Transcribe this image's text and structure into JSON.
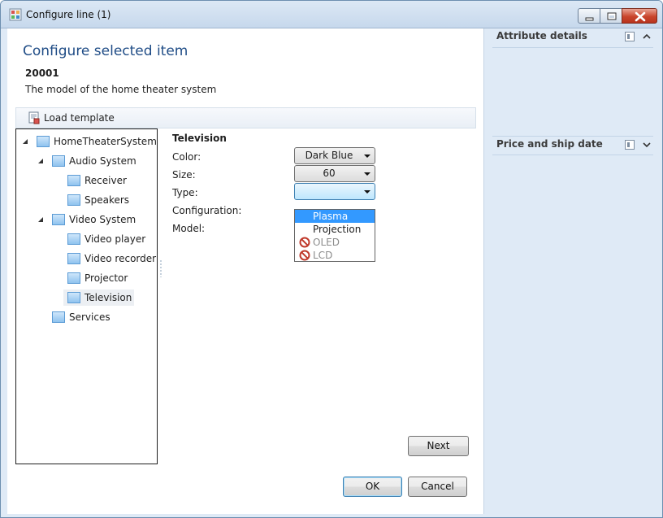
{
  "window": {
    "title": "Configure line (1)",
    "buttons": {
      "minimize": "minimize",
      "maximize": "maximize",
      "close": "close"
    }
  },
  "main": {
    "title": "Configure selected item",
    "item_id": "20001",
    "item_description": "The model of the home theater system",
    "toolbar": {
      "load_template": "Load template"
    }
  },
  "tree": {
    "items": [
      {
        "label": "HomeTheaterSystem",
        "level": 0,
        "expanded": true
      },
      {
        "label": "Audio System",
        "level": 1,
        "expanded": true
      },
      {
        "label": "Receiver",
        "level": 2
      },
      {
        "label": "Speakers",
        "level": 2
      },
      {
        "label": "Video System",
        "level": 1,
        "expanded": true
      },
      {
        "label": "Video player",
        "level": 2
      },
      {
        "label": "Video recorder",
        "level": 2
      },
      {
        "label": "Projector",
        "level": 2
      },
      {
        "label": "Television",
        "level": 2,
        "selected": true
      },
      {
        "label": "Services",
        "level": 1
      }
    ]
  },
  "attributes": {
    "section_title": "Television",
    "fields": [
      {
        "label": "Color:",
        "value": "Dark Blue"
      },
      {
        "label": "Size:",
        "value": "60"
      },
      {
        "label": "Type:",
        "value": ""
      },
      {
        "label": "Configuration:"
      },
      {
        "label": "Model:"
      }
    ],
    "type_dropdown": {
      "options": [
        {
          "label": "Plasma",
          "highlighted": true,
          "enabled": true
        },
        {
          "label": "Projection",
          "enabled": true
        },
        {
          "label": "OLED",
          "enabled": false
        },
        {
          "label": "LCD",
          "enabled": false
        }
      ]
    }
  },
  "buttons": {
    "next": "Next",
    "ok": "OK",
    "cancel": "Cancel"
  },
  "right_panel": {
    "attribute_details": "Attribute details",
    "price_and_ship_date": "Price and ship date"
  },
  "colors": {
    "title_blue": "#1f4c86",
    "panel_bg": "#dfeaf6",
    "highlight": "#3399ff",
    "tree_icon": "#8fc3ef"
  }
}
